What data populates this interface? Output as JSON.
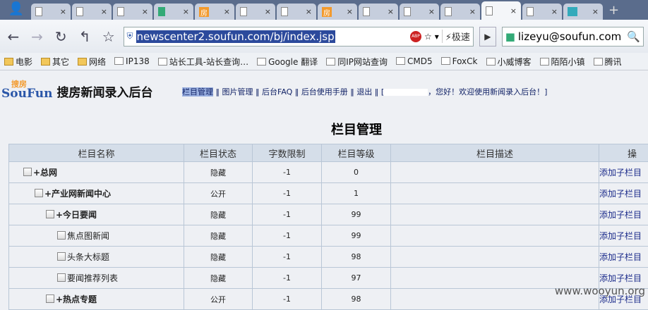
{
  "browser": {
    "tabs": [
      {
        "icon": "page"
      },
      {
        "icon": "page"
      },
      {
        "icon": "page"
      },
      {
        "icon": "google"
      },
      {
        "icon": "fang"
      },
      {
        "icon": "page"
      },
      {
        "icon": "page"
      },
      {
        "icon": "fang"
      },
      {
        "icon": "page"
      },
      {
        "icon": "page"
      },
      {
        "icon": "page"
      },
      {
        "icon": "page",
        "active": true
      },
      {
        "icon": "page"
      },
      {
        "icon": "mail"
      }
    ],
    "fang_label": "房",
    "url": "newscenter2.soufun.com/bj/index.jsp",
    "abp": "ABP",
    "speed_label": "极速",
    "search_value": "lizeyu@soufun.com",
    "bookmarks": [
      "电影",
      "其它",
      "网络",
      "IP138",
      "站长工具-站长查询…",
      "Google 翻译",
      "同IP网站查询",
      "CMD5",
      "FoxCk",
      "小威博客",
      "陌陌小镇",
      "腾讯"
    ]
  },
  "page": {
    "logo_brand": "SouFun",
    "logo_cn": "搜房",
    "site_title": "搜房新闻录入后台",
    "menu": [
      "栏目管理",
      "图片管理",
      "后台FAQ",
      "后台使用手册",
      "退出"
    ],
    "welcome_prefix": "[",
    "welcome": "，您好！欢迎使用新闻录入后台！]",
    "heading": "栏目管理",
    "columns": [
      "栏目名称",
      "栏目状态",
      "字数限制",
      "栏目等级",
      "栏目描述",
      "操"
    ],
    "rows": [
      {
        "name": "+总网",
        "status": "隐藏",
        "limit": "-1",
        "level": "0",
        "desc": "",
        "op": "添加子栏目"
      },
      {
        "name": "+产业网新闻中心",
        "status": "公开",
        "limit": "-1",
        "level": "1",
        "desc": "",
        "op": "添加子栏目"
      },
      {
        "name": "+今日要闻",
        "status": "隐藏",
        "limit": "-1",
        "level": "99",
        "desc": "",
        "op": "添加子栏目"
      },
      {
        "name": "焦点图新闻",
        "status": "隐藏",
        "limit": "-1",
        "level": "99",
        "desc": "",
        "op": "添加子栏目"
      },
      {
        "name": "头条大标题",
        "status": "隐藏",
        "limit": "-1",
        "level": "98",
        "desc": "",
        "op": "添加子栏目"
      },
      {
        "name": "要闻推荐列表",
        "status": "隐藏",
        "limit": "-1",
        "level": "97",
        "desc": "",
        "op": "添加子栏目"
      },
      {
        "name": "+热点专题",
        "status": "公开",
        "limit": "-1",
        "level": "98",
        "desc": "",
        "op": "添加子栏目"
      }
    ]
  },
  "watermark": "www.wooyun.org"
}
